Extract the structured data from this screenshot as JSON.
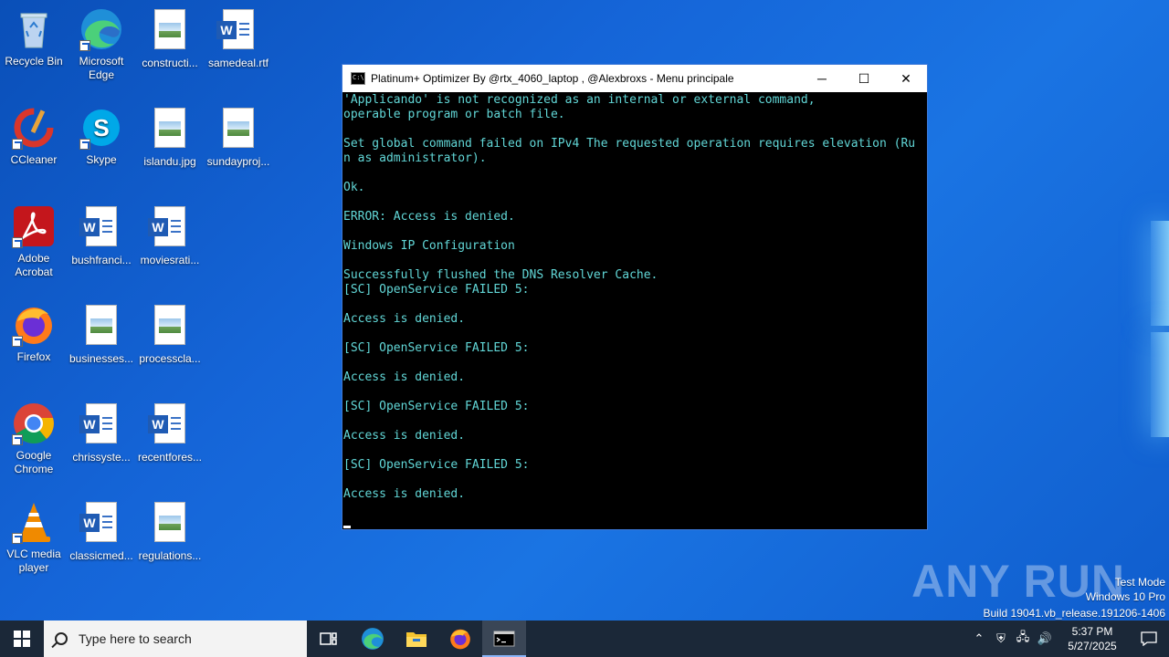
{
  "desktop": {
    "icons": [
      {
        "label": "Recycle Bin"
      },
      {
        "label": "Microsoft Edge"
      },
      {
        "label": "constructi..."
      },
      {
        "label": "samedeal.rtf"
      },
      {
        "label": "CCleaner"
      },
      {
        "label": "Skype"
      },
      {
        "label": "islandu.jpg"
      },
      {
        "label": "sundayproj..."
      },
      {
        "label": "Adobe Acrobat"
      },
      {
        "label": "bushfranci..."
      },
      {
        "label": "moviesrati..."
      },
      {
        "label": "Firefox"
      },
      {
        "label": "businesses..."
      },
      {
        "label": "processcla..."
      },
      {
        "label": "Google Chrome"
      },
      {
        "label": "chrissyste..."
      },
      {
        "label": "recentfores..."
      },
      {
        "label": "VLC media player"
      },
      {
        "label": "classicmed..."
      },
      {
        "label": "regulations..."
      }
    ]
  },
  "cmd": {
    "title": "Platinum+ Optimizer By @rtx_4060_laptop , @Alexbroxs - Menu principale",
    "icon_text": "C:\\",
    "minimize": "─",
    "maximize": "☐",
    "close": "✕",
    "output": "'Applicando' is not recognized as an internal or external command,\noperable program or batch file.\n\nSet global command failed on IPv4 The requested operation requires elevation (Ru\nn as administrator).\n\nOk.\n\nERROR: Access is denied.\n\nWindows IP Configuration\n\nSuccessfully flushed the DNS Resolver Cache.\n[SC] OpenService FAILED 5:\n\nAccess is denied.\n\n[SC] OpenService FAILED 5:\n\nAccess is denied.\n\n[SC] OpenService FAILED 5:\n\nAccess is denied.\n\n[SC] OpenService FAILED 5:\n\nAccess is denied."
  },
  "watermark": {
    "logo": "ANY RUN",
    "line1": "Test Mode",
    "line2": "Windows 10 Pro",
    "line3": "Build 19041.vb_release.191206-1406"
  },
  "taskbar": {
    "search_placeholder": "Type here to search",
    "time": "5:37 PM",
    "date": "5/27/2025"
  }
}
